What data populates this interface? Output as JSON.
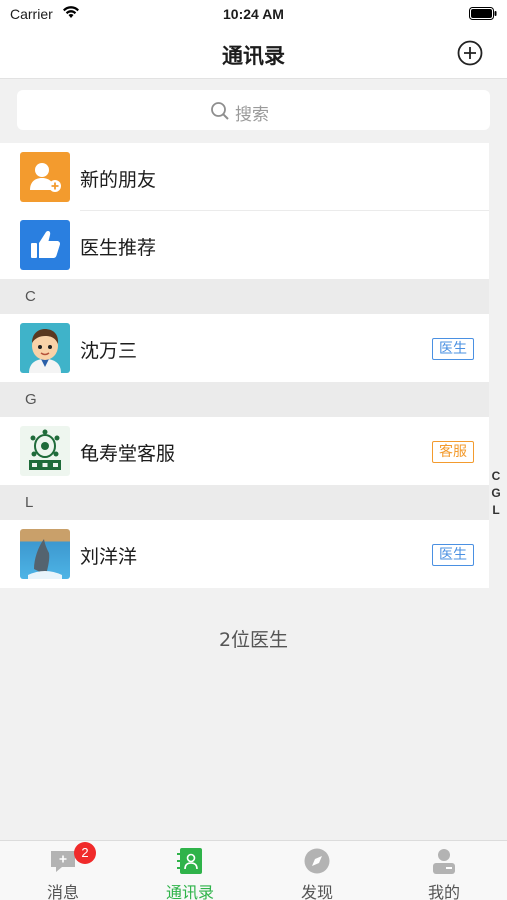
{
  "status_bar": {
    "carrier": "Carrier",
    "time": "10:24 AM"
  },
  "nav": {
    "title": "通讯录",
    "add_icon": "plus-circle-icon"
  },
  "search": {
    "placeholder": "搜索"
  },
  "top_items": [
    {
      "label": "新的朋友",
      "icon": "add-friend-icon",
      "color": "#f39b2e"
    },
    {
      "label": "医生推荐",
      "icon": "thumbs-up-icon",
      "color": "#2a7fe0"
    }
  ],
  "sections": [
    {
      "letter": "C",
      "contacts": [
        {
          "name": "沈万三",
          "tag": "医生",
          "avatar": "cartoon-boy-avatar"
        }
      ]
    },
    {
      "letter": "G",
      "contacts": [
        {
          "name": "龟寿堂客服",
          "tag": "客服",
          "avatar": "turtle-logo-avatar"
        }
      ]
    },
    {
      "letter": "L",
      "contacts": [
        {
          "name": "刘洋洋",
          "tag": "医生",
          "avatar": "dolphin-photo-avatar"
        }
      ]
    }
  ],
  "footer": {
    "count_text": "2位医生"
  },
  "index": [
    "C",
    "G",
    "L"
  ],
  "tabs": [
    {
      "label": "消息",
      "icon": "message-icon",
      "badge": "2"
    },
    {
      "label": "通讯录",
      "icon": "contacts-icon",
      "active": true
    },
    {
      "label": "发现",
      "icon": "compass-icon"
    },
    {
      "label": "我的",
      "icon": "profile-icon"
    }
  ],
  "colors": {
    "active_green": "#2fb34a",
    "doctor_tag": "#4a90e2",
    "service_tag": "#f39b2e",
    "badge_red": "#f02a2a"
  }
}
